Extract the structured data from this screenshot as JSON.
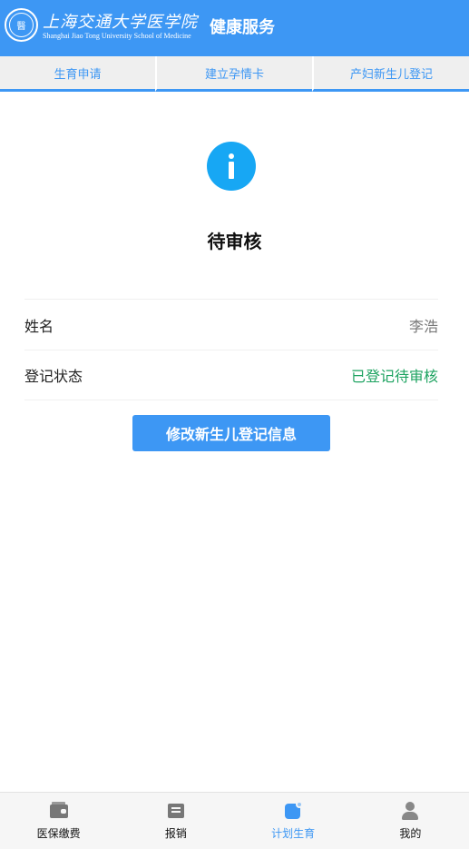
{
  "header": {
    "logo_cn": "上海交通大学医学院",
    "logo_en": "Shanghai Jiao Tong University School of Medicine",
    "title": "健康服务"
  },
  "tabs": [
    {
      "label": "生育申请"
    },
    {
      "label": "建立孕情卡"
    },
    {
      "label": "产妇新生儿登记"
    }
  ],
  "status": {
    "icon": "info-icon",
    "title": "待审核"
  },
  "details": {
    "name_label": "姓名",
    "name_value": "李浩",
    "state_label": "登记状态",
    "state_value": "已登记待审核"
  },
  "action": {
    "button_label": "修改新生儿登记信息"
  },
  "bottom_nav": [
    {
      "label": "医保缴费",
      "icon": "wallet-icon"
    },
    {
      "label": "报销",
      "icon": "report-icon"
    },
    {
      "label": "计划生育",
      "icon": "plan-icon",
      "active": true
    },
    {
      "label": "我的",
      "icon": "user-icon"
    }
  ],
  "colors": {
    "primary": "#3d97f4",
    "info_icon": "#17a7f4",
    "success_text": "#1ea361"
  }
}
